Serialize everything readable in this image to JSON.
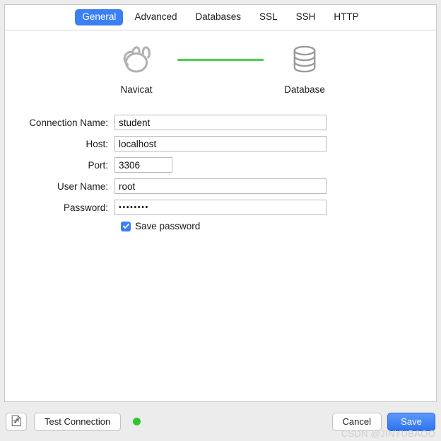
{
  "dialog": {
    "tabs": [
      {
        "label": "General",
        "active": true,
        "name": "tab-general"
      },
      {
        "label": "Advanced",
        "active": false,
        "name": "tab-advanced"
      },
      {
        "label": "Databases",
        "active": false,
        "name": "tab-databases"
      },
      {
        "label": "SSL",
        "active": false,
        "name": "tab-ssl"
      },
      {
        "label": "SSH",
        "active": false,
        "name": "tab-ssh"
      },
      {
        "label": "HTTP",
        "active": false,
        "name": "tab-http"
      }
    ]
  },
  "diagram": {
    "source_icon": "navicat-logo-icon",
    "source_label": "Navicat",
    "connector_icon": "connection-line",
    "connector_color": "#4ad04a",
    "target_icon": "database-cylinder-icon",
    "target_label": "Database"
  },
  "form": {
    "fields": [
      {
        "label": "Connection Name:",
        "value": "student",
        "placeholder": "",
        "width": "wide"
      },
      {
        "label": "Host:",
        "value": "localhost",
        "placeholder": "",
        "width": "wide"
      },
      {
        "label": "Port:",
        "value": "3306",
        "placeholder": "",
        "width": "narrow"
      },
      {
        "label": "User Name:",
        "value": "root",
        "placeholder": "",
        "width": "wide"
      },
      {
        "label": "Password:",
        "value": "••••••••",
        "placeholder": "",
        "width": "wide"
      }
    ],
    "save_password": {
      "label": "Save password",
      "checked": true
    }
  },
  "footer": {
    "settings_icon": "page-export-icon",
    "test_connection_label": "Test Connection",
    "status_icon": "status-dot-icon",
    "status_color": "#2ec62e",
    "cancel_label": "Cancel",
    "save_label": "Save"
  },
  "watermark": {
    "text": "CSDN @JINYUBAOO"
  },
  "colors": {
    "accent": "#3b7ff5",
    "success": "#4ad04a",
    "panel_bg": "#ffffff",
    "window_bg": "#ececec"
  }
}
